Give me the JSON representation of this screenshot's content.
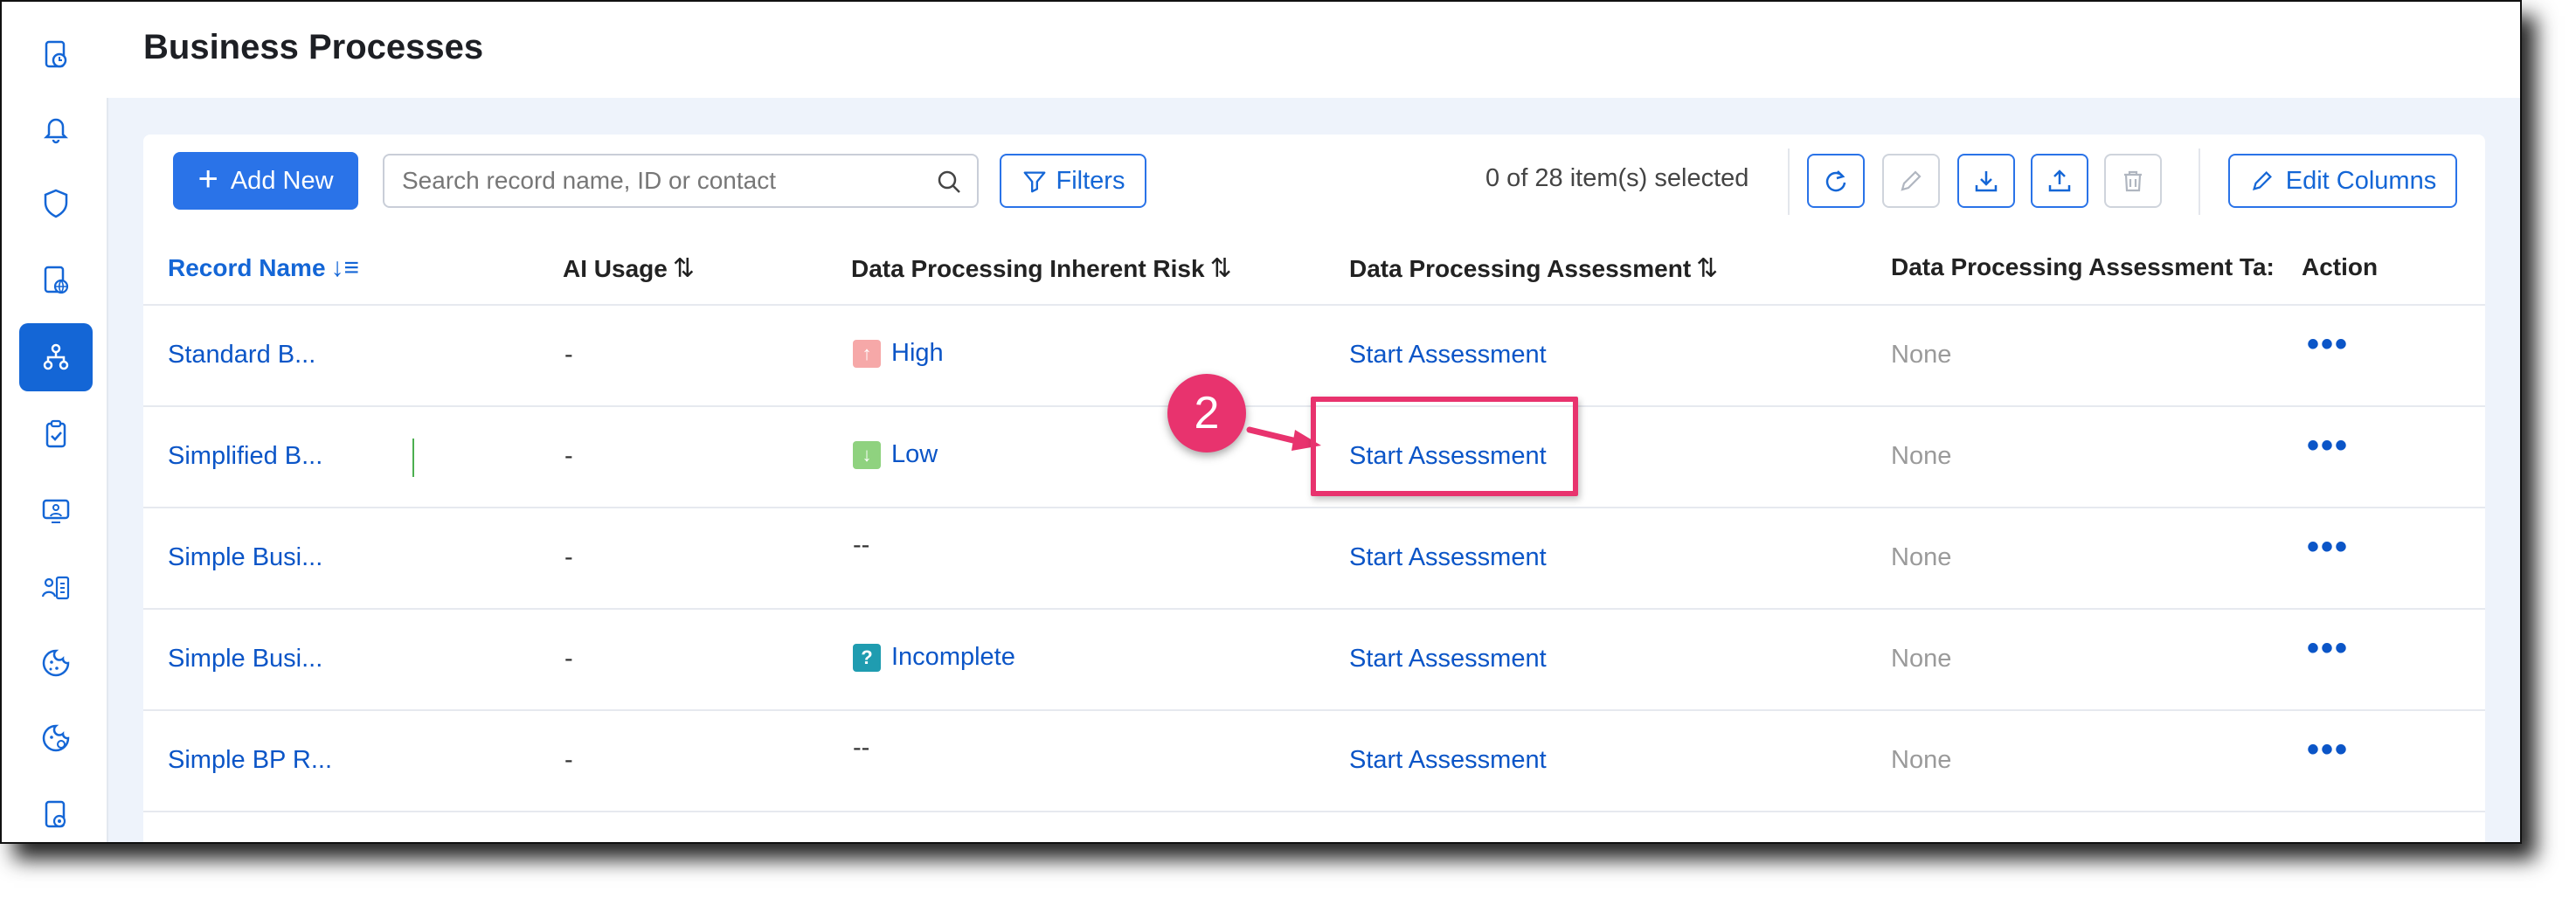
{
  "page": {
    "title": "Business Processes"
  },
  "sidebar": {
    "items": [
      {
        "icon": "report-clock-icon",
        "active": false
      },
      {
        "icon": "bell-icon",
        "active": false
      },
      {
        "icon": "shield-icon",
        "active": false
      },
      {
        "icon": "globe-document-icon",
        "active": false
      },
      {
        "icon": "hierarchy-icon",
        "active": true
      },
      {
        "icon": "clipboard-check-icon",
        "active": false
      },
      {
        "icon": "monitor-user-icon",
        "active": false
      },
      {
        "icon": "user-list-icon",
        "active": false
      },
      {
        "icon": "cookie-icon",
        "active": false
      },
      {
        "icon": "cookie-settings-icon",
        "active": false
      },
      {
        "icon": "document-gear-icon",
        "active": false
      }
    ]
  },
  "toolbar": {
    "add_new_label": "Add New",
    "search_placeholder": "Search record name, ID or contact",
    "filters_label": "Filters",
    "selected_count": "0 of 28 item(s) selected",
    "edit_columns_label": "Edit Columns",
    "icon_buttons": [
      "refresh-icon",
      "pencil-icon",
      "download-icon",
      "upload-icon",
      "trash-icon"
    ]
  },
  "table": {
    "headers": {
      "record_name": "Record Name",
      "ai_usage": "AI Usage",
      "risk": "Data Processing Inherent Risk",
      "assessment": "Data Processing Assessment",
      "assessment_task": "Data Processing Assessment Ta:",
      "action": "Action"
    },
    "rows": [
      {
        "name": "Standard B...",
        "ai": "-",
        "risk": "High",
        "risk_level": "high",
        "assessment": "Start Assessment",
        "task": "None",
        "action": "•••"
      },
      {
        "name": "Simplified B...",
        "ai": "-",
        "risk": "Low",
        "risk_level": "low",
        "assessment": "Start Assessment",
        "task": "None",
        "action": "•••"
      },
      {
        "name": "Simple Busi...",
        "ai": "-",
        "risk": "--",
        "risk_level": "none",
        "assessment": "Start Assessment",
        "task": "None",
        "action": "•••"
      },
      {
        "name": "Simple Busi...",
        "ai": "-",
        "risk": "Incomplete",
        "risk_level": "incomplete",
        "assessment": "Start Assessment",
        "task": "None",
        "action": "•••"
      },
      {
        "name": "Simple BP R...",
        "ai": "-",
        "risk": "--",
        "risk_level": "none",
        "assessment": "Start Assessment",
        "task": "None",
        "action": "•••"
      }
    ]
  },
  "annotation": {
    "step_number": "2",
    "color": "#e8336e"
  },
  "colors": {
    "accent": "#2a73e8",
    "link": "#0b55c7",
    "sidebar_active": "#1466d6"
  }
}
